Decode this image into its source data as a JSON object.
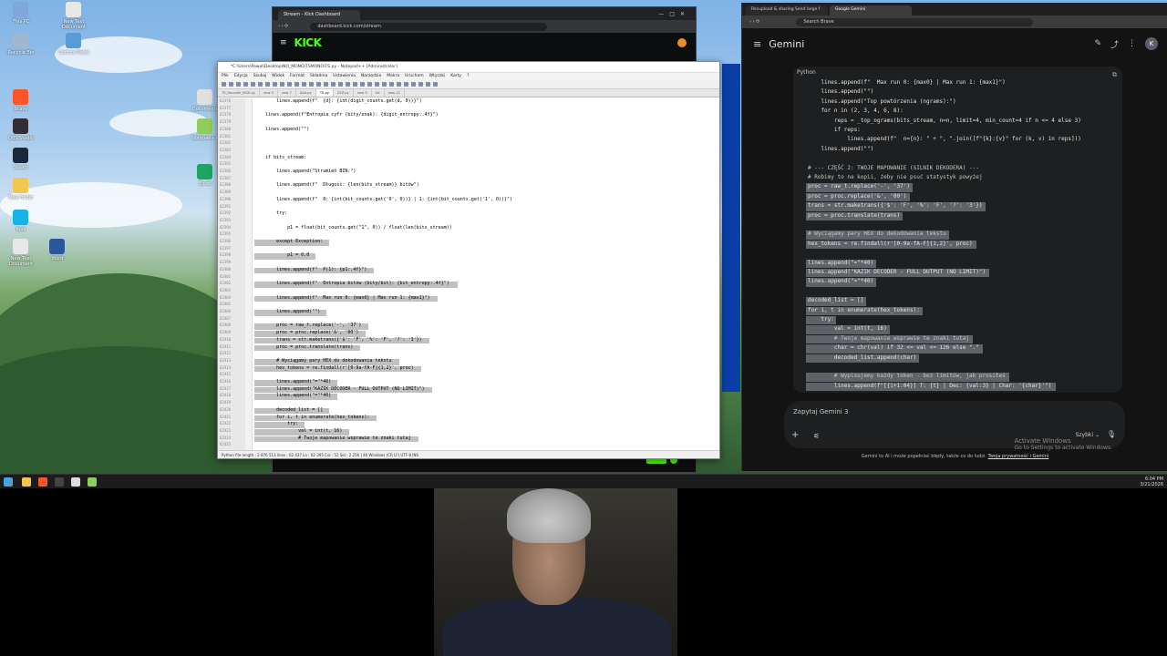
{
  "desktop": {
    "icons": [
      {
        "label": "This PC",
        "color": "#7fa7d8"
      },
      {
        "label": "New Text Document",
        "color": "#e8e8e8"
      },
      {
        "label": "Recycle Bin",
        "color": "#9fb8d0"
      },
      {
        "label": "Control Panel",
        "color": "#5b9bd5"
      },
      {
        "label": "Brave",
        "color": "#fb542b"
      },
      {
        "label": "OBS Studio",
        "color": "#302e31"
      },
      {
        "label": "Steam",
        "color": "#1b2838"
      },
      {
        "label": "New folder",
        "color": "#f3c64d"
      },
      {
        "label": "Kodi",
        "color": "#17b2e7"
      },
      {
        "label": "Documents",
        "color": "#e0e0e0"
      },
      {
        "label": "Notepad++",
        "color": "#8fce5c"
      },
      {
        "label": "Excel",
        "color": "#21a366"
      },
      {
        "label": "New Text Document",
        "color": "#e8e8e8"
      },
      {
        "label": "Word",
        "color": "#2b579a"
      }
    ]
  },
  "taskbar": {
    "time": "6:04 PM",
    "date": "3/21/2026"
  },
  "kick": {
    "tab_title": "Stream - Kick Dashboard",
    "url": "dashboard.kick.com/stream",
    "logo": "KICK"
  },
  "npp": {
    "title": "*C:\\Users\\Pawel\\Desktop\\NO_MONO\\TSMONO\\TS.py - Notepad++ [Administrator]",
    "menu": [
      "Plik",
      "Edycja",
      "Szukaj",
      "Widok",
      "Format",
      "Składnia",
      "Ustawienia",
      "Narzędzia",
      "Makra",
      "Uruchom",
      "Wtyczki",
      "Karty",
      "?"
    ],
    "tabs": [
      "TS_Decoder_KICK.py",
      "new 3",
      "new 7",
      "AAA.py",
      "TS.py",
      "ZZZ.py",
      "new 9",
      "txt",
      "new 12"
    ],
    "line_numbers": [
      "62376",
      "62377",
      "62378",
      "62379",
      "62380",
      "62381",
      "62382",
      "62383",
      "62384",
      "62385",
      "62386",
      "62387",
      "62388",
      "62389",
      "62390",
      "62391",
      "62392",
      "62393",
      "62394",
      "62395",
      "62396",
      "62397",
      "62398",
      "62399",
      "62400",
      "62401",
      "62402",
      "62403",
      "62404",
      "62405",
      "62406",
      "62407",
      "62408",
      "62409",
      "62410",
      "62411",
      "62412",
      "62413",
      "62414",
      "62415",
      "62416",
      "62417",
      "62418",
      "62419",
      "62420",
      "62421",
      "62422",
      "62423",
      "62424",
      "62425"
    ],
    "code": [
      "        lines.append(f\"  {d}: {int(digit_counts.get(d, 0))}\")",
      "",
      "    lines.append(f\"Entropia cyfr (bity/znak): {digit_entropy:.4f}\")",
      "",
      "    lines.append(\"\")",
      "",
      "",
      "",
      "    if bits_stream:",
      "",
      "        lines.append(\"Strumień BIN:\")",
      "",
      "        lines.append(f\"  Długość: {len(bits_stream)} bitów\")",
      "",
      "        lines.append(f\"  0: {int(bit_counts.get('0', 0))} | 1: {int(bit_counts.get('1', 0))}\")",
      "",
      "        try:",
      "",
      "            p1 = float(bit_counts.get(\"1\", 0)) / float(len(bits_stream))",
      "",
      "        except Exception:",
      "",
      "            p1 = 0.0",
      "",
      "        lines.append(f\"  P(1): {p1:.4f}\")",
      "",
      "        lines.append(f\"  Entropia bitów (bity/bit): {bit_entropy:.4f}\")",
      "",
      "        lines.append(f\"  Max run 0: {max0} | Max run 1: {max1}\")",
      "",
      "        lines.append(\"\")",
      "",
      "        proc = raw_t.replace('-', '37')",
      "        proc = proc.replace('&', '00')",
      "        trans = str.maketrans({'$': 'F', '%': 'F', '?': '3'})",
      "        proc = proc.translate(trans)",
      "",
      "        # Wyciągamy pary HEX do dekodowania tekstu",
      "        hex_tokens = re.findall(r'[0-9a-fA-F]{1,2}', proc)",
      "",
      "        lines.append(\"=\"*40)",
      "        lines.append(\"KAZIK DECODER - FULL OUTPUT (NO LIMIT)\")",
      "        lines.append(\"=\"*40)",
      "",
      "        decoded_list = []",
      "        for i, t in enumerate(hex_tokens):",
      "            try:",
      "                val = int(t, 16)",
      "                # Twoje mapowanie wsprawie te znaki tutaj"
    ],
    "status": "Python file    length : 2 876 513    lines : 62 437    Ln : 62 395    Col : 52    Sel : 2 256 | 46    Windows (CR LF)    UTF-8    INS"
  },
  "gemini": {
    "tabs": [
      "Recupload & sharing Send large f",
      "Google Gemini"
    ],
    "url": "Search Brave",
    "title": "Gemini",
    "avatar": "K",
    "code_lang": "Python",
    "code": [
      "    lines.append(f\"  Max run 0: {max0} | Max run 1: {max1}\")",
      "    lines.append(\"\")",
      "    lines.append(\"Top powtórzenia (ngrams):\")",
      "    for n in (2, 3, 4, 6, 8):",
      "        reps = _top_ngrams(bits_stream, n=n, limit=4, min_count=4 if n <= 4 else 3)",
      "        if reps:",
      "            lines.append(f\"  n={n}: \" + \", \".join([f\"{k}:{v}\" for (k, v) in reps]))",
      "    lines.append(\"\")",
      "",
      "# --- CZĘŚĆ 2: TWOJE MAPOWANIE (SILNIK DEKODERA) ---",
      "# Robimy to na kopii, żeby nie psuć statystyk powyżej",
      "proc = raw_t.replace('-', '37')",
      "proc = proc.replace('&', '00')",
      "trans = str.maketrans({'$': 'F', '%': 'F', '?': '3'})",
      "proc = proc.translate(trans)",
      "",
      "# Wyciągamy pary HEX do dekodowania tekstu",
      "hex_tokens = re.findall(r'[0-9a-fA-F]{1,2}', proc)",
      "",
      "lines.append(\"=\"*40)",
      "lines.append(\"KAZIK DECODER - FULL OUTPUT (NO LIMIT)\")",
      "lines.append(\"=\"*40)",
      "",
      "decoded_list = []",
      "for i, t in enumerate(hex_tokens):",
      "    try:",
      "        val = int(t, 16)",
      "        # Twoje mapowanie wsprawie te znaki tutaj",
      "        char = chr(val) if 32 <= val <= 126 else \".\"",
      "        decoded_list.append(char)",
      "",
      "        # Wypisujemy każdy token - bez limitów, jak prosiłeś",
      "        lines.append(f\"[{i+1:04}] T: {t} | Dec: {val:3} | Char: '{char}'\")"
    ],
    "prompt_placeholder": "Zapytaj Gemini 3",
    "mode": "Szybki",
    "footer": "Gemini to AI i może popełniać błędy, także co do ludzi.",
    "footer_link": "Twoja prywatność i Gemini",
    "activate_line1": "Activate Windows",
    "activate_line2": "Go to Settings to activate Windows."
  }
}
